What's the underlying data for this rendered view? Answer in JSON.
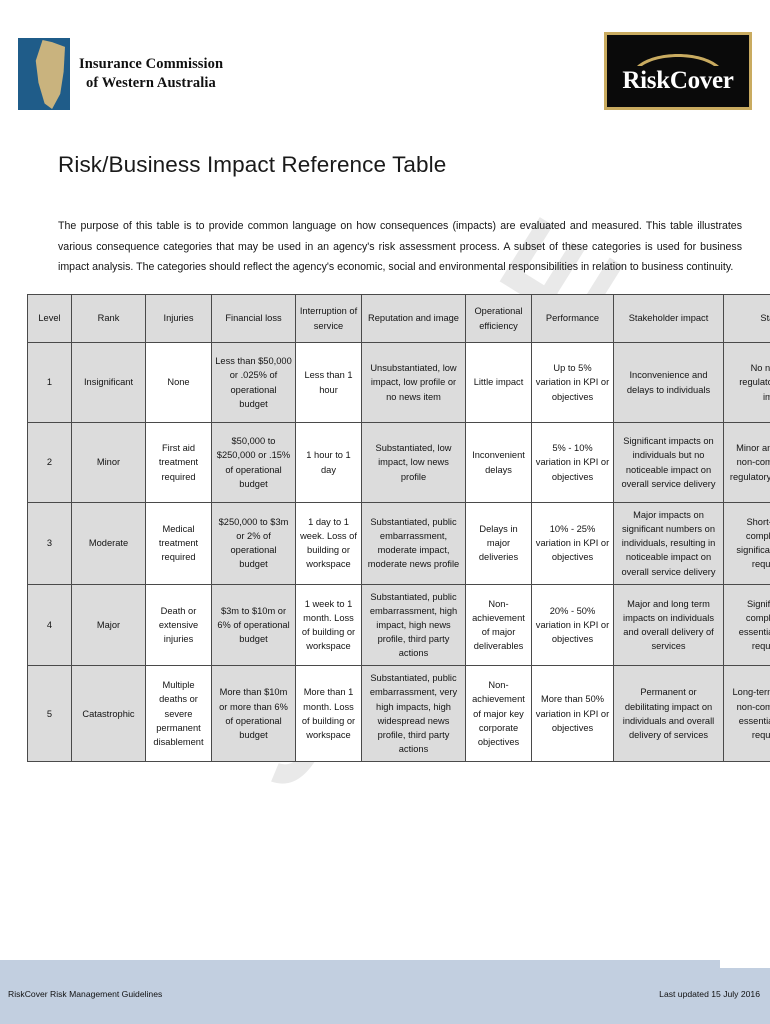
{
  "header": {
    "icwa_logo": {
      "line1": "Insurance Commission",
      "line2": "of Western Australia"
    },
    "riskcover_logo": {
      "text": "RiskCover"
    }
  },
  "document": {
    "title": "Risk/Business Impact Reference Table",
    "intro": "The purpose of this table is to provide common language on how consequences (impacts) are evaluated and measured.  This table illustrates various consequence categories that may be used in an agency's risk assessment process.  A subset of these categories is used for business impact analysis.  The categories should reflect the agency's economic, social and environmental responsibilities in relation to business continuity.",
    "watermark": "SAMPLE"
  },
  "table": {
    "headers": [
      "Level",
      "Rank",
      "Injuries",
      "Financial loss",
      "Interruption of service",
      "Reputation and image",
      "Operational efficiency",
      "Performance",
      "Stakeholder impact",
      "Statutory"
    ],
    "rows": [
      {
        "level": "1",
        "rank": "Insignificant",
        "injuries": "None",
        "financial_loss": "Less than $50,000 or .025% of operational budget",
        "interruption_of_service": "Less than 1 hour",
        "reputation_and_image": "Unsubstantiated, low impact, low profile or no news item",
        "operational_efficiency": "Little impact",
        "performance": "Up to 5% variation in KPI or objectives",
        "stakeholder_impact": "Inconvenience and delays to individuals",
        "statutory": "No noticeable regulatory/statutory impacts"
      },
      {
        "level": "2",
        "rank": "Minor",
        "injuries": "First aid treatment required",
        "financial_loss": "$50,000 to $250,000 or .15% of operational budget",
        "interruption_of_service": "1 hour to 1 day",
        "reputation_and_image": "Substantiated, low impact, low news profile",
        "operational_efficiency": "Inconvenient delays",
        "performance": "5% - 10% variation in KPI or objectives",
        "stakeholder_impact": "Significant impacts on individuals but no noticeable impact on overall service delivery",
        "statutory": "Minor and temporary non-compliance with regulatory requirements"
      },
      {
        "level": "3",
        "rank": "Moderate",
        "injuries": "Medical treatment required",
        "financial_loss": "$250,000 to $3m or 2% of operational budget",
        "interruption_of_service": "1 day to 1 week.  Loss of building or workspace",
        "reputation_and_image": "Substantiated, public embarrassment, moderate impact, moderate news profile",
        "operational_efficiency": "Delays in major deliveries",
        "performance": "10% - 25% variation in KPI or objectives",
        "stakeholder_impact": "Major impacts on significant numbers on individuals, resulting in noticeable impact on overall service delivery",
        "statutory": "Short-term non-compliance with significant regulatory requirements"
      },
      {
        "level": "4",
        "rank": "Major",
        "injuries": "Death or extensive injuries",
        "financial_loss": "$3m to $10m or 6% of operational budget",
        "interruption_of_service": "1 week to 1 month.  Loss of building or workspace",
        "reputation_and_image": "Substantiated, public embarrassment, high impact, high news profile, third party actions",
        "operational_efficiency": "Non-achievement of major deliverables",
        "performance": "20% -  50% variation in KPI or objectives",
        "stakeholder_impact": "Major and long term impacts on individuals and overall delivery of services",
        "statutory": "Significant non-compliance with essential regulatory requirements"
      },
      {
        "level": "5",
        "rank": "Catastrophic",
        "injuries": "Multiple deaths or severe permanent disablement",
        "financial_loss": "More than $10m or more than 6% of operational budget",
        "interruption_of_service": "More than 1 month.  Loss of building or workspace",
        "reputation_and_image": "Substantiated, public embarrassment, very high impacts, high widespread news profile, third party actions",
        "operational_efficiency": "Non-achievement of major key corporate objectives",
        "performance": "More than 50% variation in KPI or objectives",
        "stakeholder_impact": "Permanent or debilitating impact on individuals and overall delivery of services",
        "statutory": "Long-term or indefinite non-compliance with essential regulatory requirements"
      }
    ]
  },
  "footer": {
    "left": "RiskCover Risk Management Guidelines",
    "right": "Last updated 15 July 2016"
  },
  "colors": {
    "icwa_blue": "#1f5c89",
    "icwa_gold": "#c9b37e",
    "riskcover_gold": "#c9ab60",
    "riskcover_black": "#0a0a0a",
    "table_shaded": "#dcdcdc",
    "footer_band": "#c2cfe0",
    "watermark": "#e9e9e9"
  }
}
